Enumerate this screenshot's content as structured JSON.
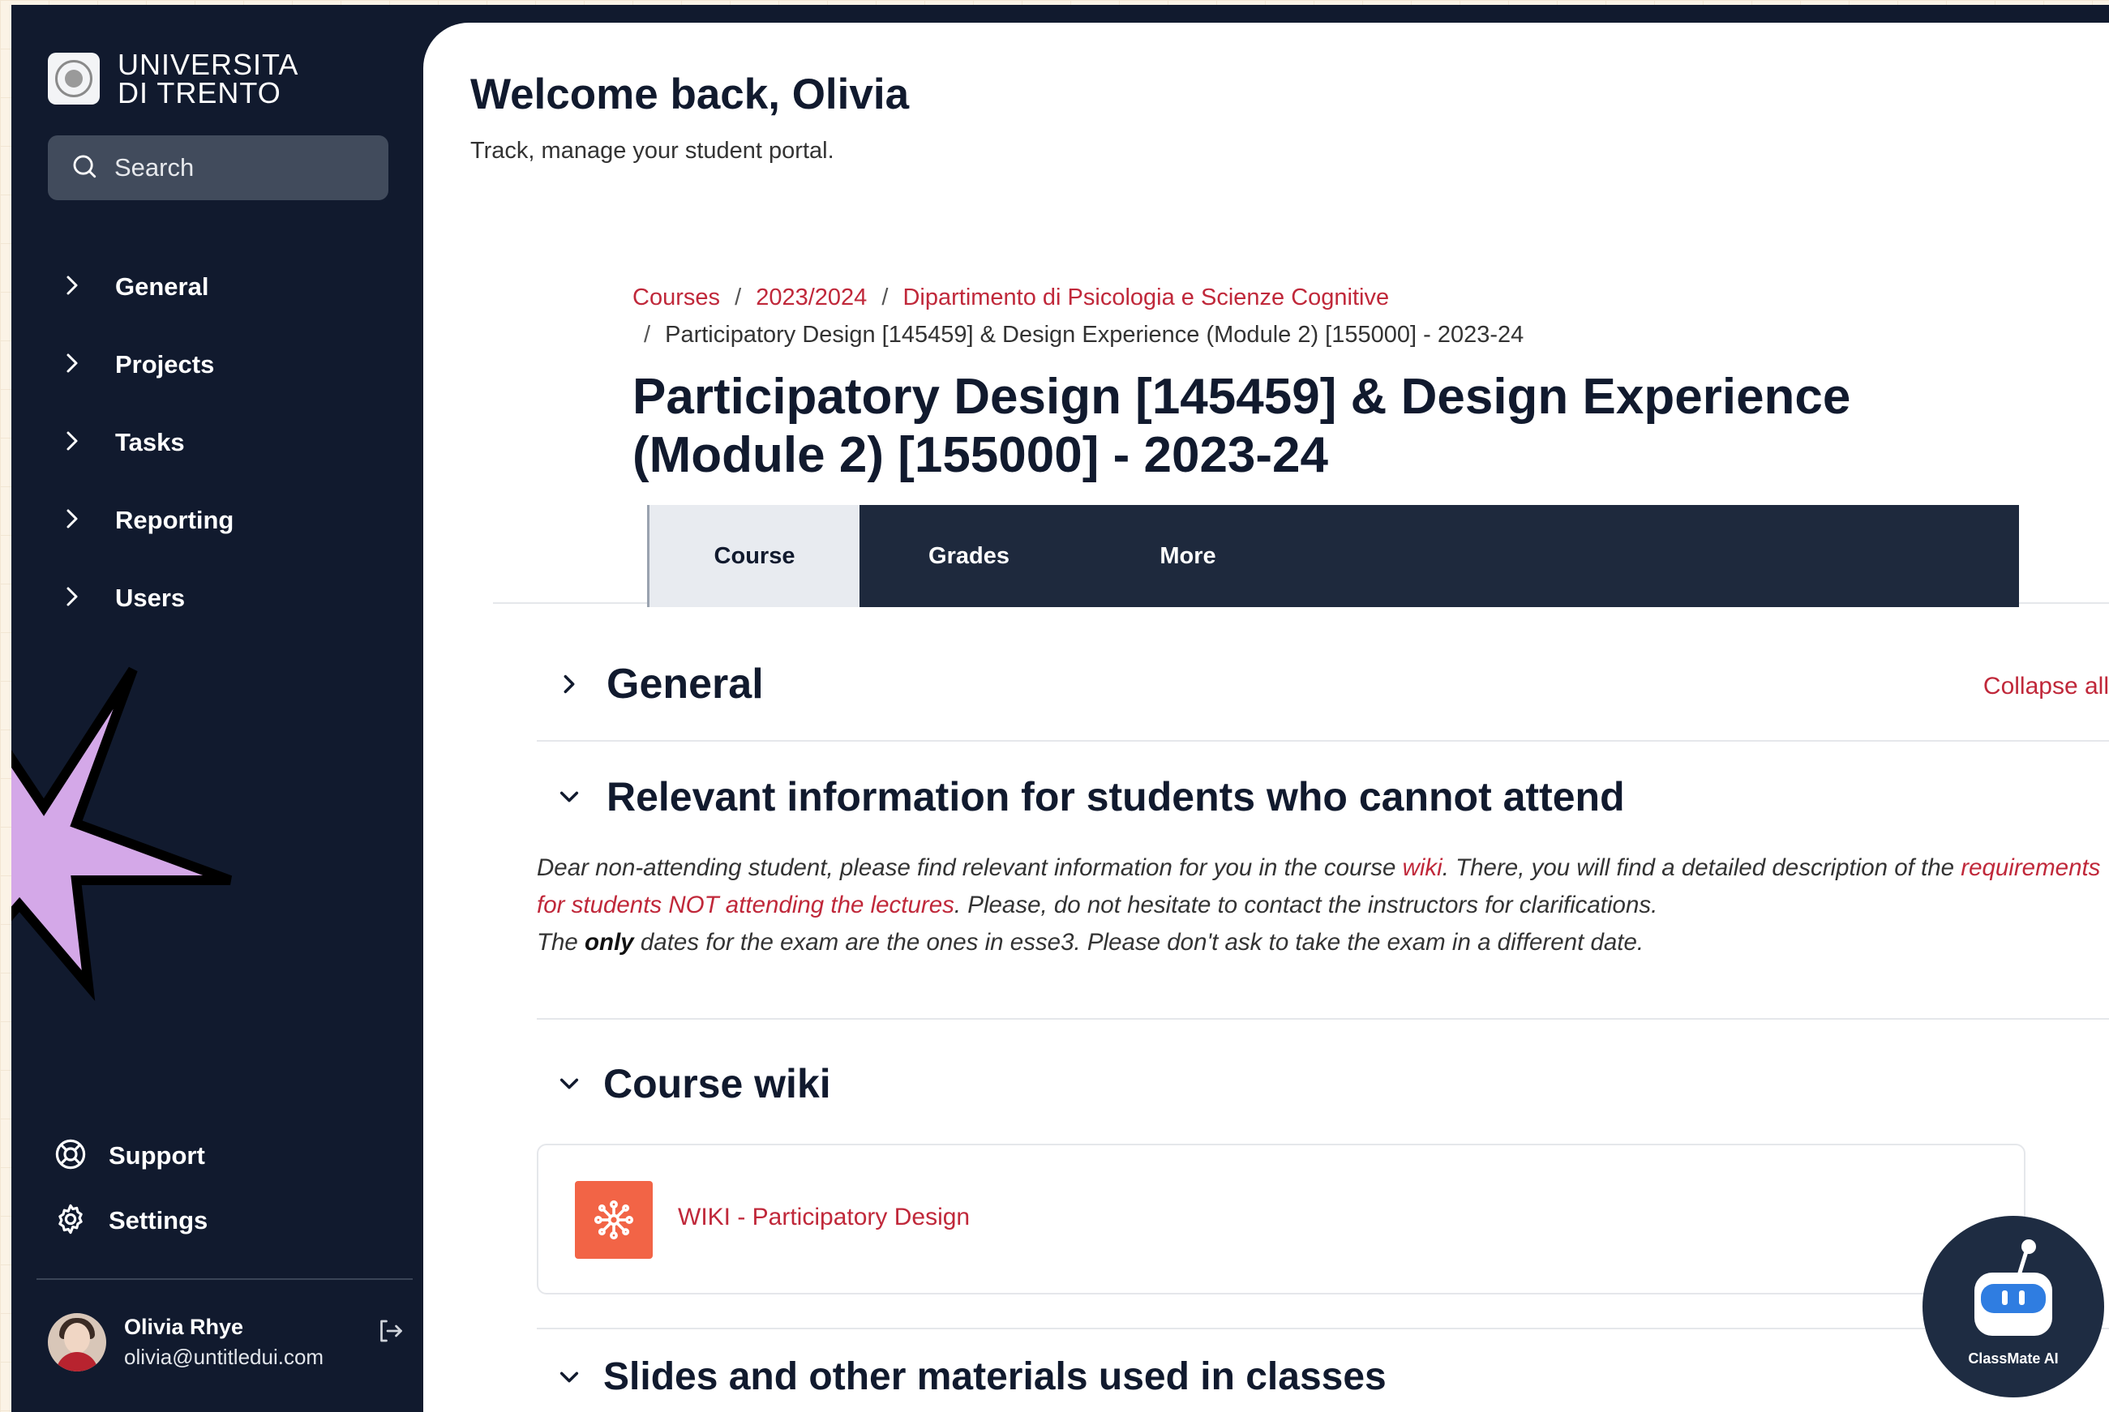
{
  "sidebar": {
    "logo": {
      "line1": "UNIVERSITA",
      "line2": "DI TRENTO"
    },
    "search": {
      "placeholder": "Search",
      "icon": "search-icon"
    },
    "items": [
      {
        "label": "General",
        "icon": "chevron-right-icon"
      },
      {
        "label": "Projects",
        "icon": "chevron-right-icon"
      },
      {
        "label": "Tasks",
        "icon": "chevron-right-icon"
      },
      {
        "label": "Reporting",
        "icon": "chevron-right-icon"
      },
      {
        "label": "Users",
        "icon": "chevron-right-icon"
      }
    ],
    "bottom_items": [
      {
        "label": "Support",
        "icon": "lifebuoy-icon"
      },
      {
        "label": "Settings",
        "icon": "gear-icon"
      }
    ],
    "user": {
      "name": "Olivia Rhye",
      "email": "olivia@untitledui.com"
    }
  },
  "header": {
    "welcome": "Welcome back, Olivia",
    "subtitle": "Track, manage your student portal."
  },
  "breadcrumb": {
    "links": [
      "Courses",
      "2023/2024",
      "Dipartimento di Psicologia e Scienze Cognitive"
    ],
    "separator": "/",
    "current": "Participatory Design [145459] & Design Experience (Module 2) [155000] - 2023-24"
  },
  "course": {
    "title": "Participatory Design [145459] & Design Experience (Module 2) [155000] - 2023-24",
    "tabs": [
      {
        "label": "Course",
        "active": true
      },
      {
        "label": "Grades",
        "active": false
      },
      {
        "label": "More",
        "active": false
      }
    ]
  },
  "sections": {
    "general": {
      "title": "General",
      "collapse_all": "Collapse all"
    },
    "attend": {
      "title": "Relevant information for students who cannot attend",
      "p1_a": "Dear non-attending student, please find relevant information for you in the course ",
      "p1_link1": "wiki",
      "p1_b": ". There, you will find a detailed description of the ",
      "p1_link2": "requirements for students NOT attending the lectures",
      "p1_c": ". Please, do not hesitate to contact the instructors for clarifications.",
      "p2_a": "The ",
      "p2_bold": "only",
      "p2_b": " dates for the exam are the ones in esse3. Please don't ask to take the exam in a different date."
    },
    "wiki": {
      "title": "Course wiki",
      "item": "WIKI - Participatory Design"
    },
    "slides": {
      "title": "Slides and other materials used in classes"
    }
  },
  "assistant": {
    "label": "ClassMate AI"
  },
  "colors": {
    "sidebar_bg": "#111a2e",
    "accent_red": "#c0283a",
    "wiki_orange": "#f26446",
    "tab_bar": "#1e293d",
    "starburst": "#d4a8e8"
  }
}
